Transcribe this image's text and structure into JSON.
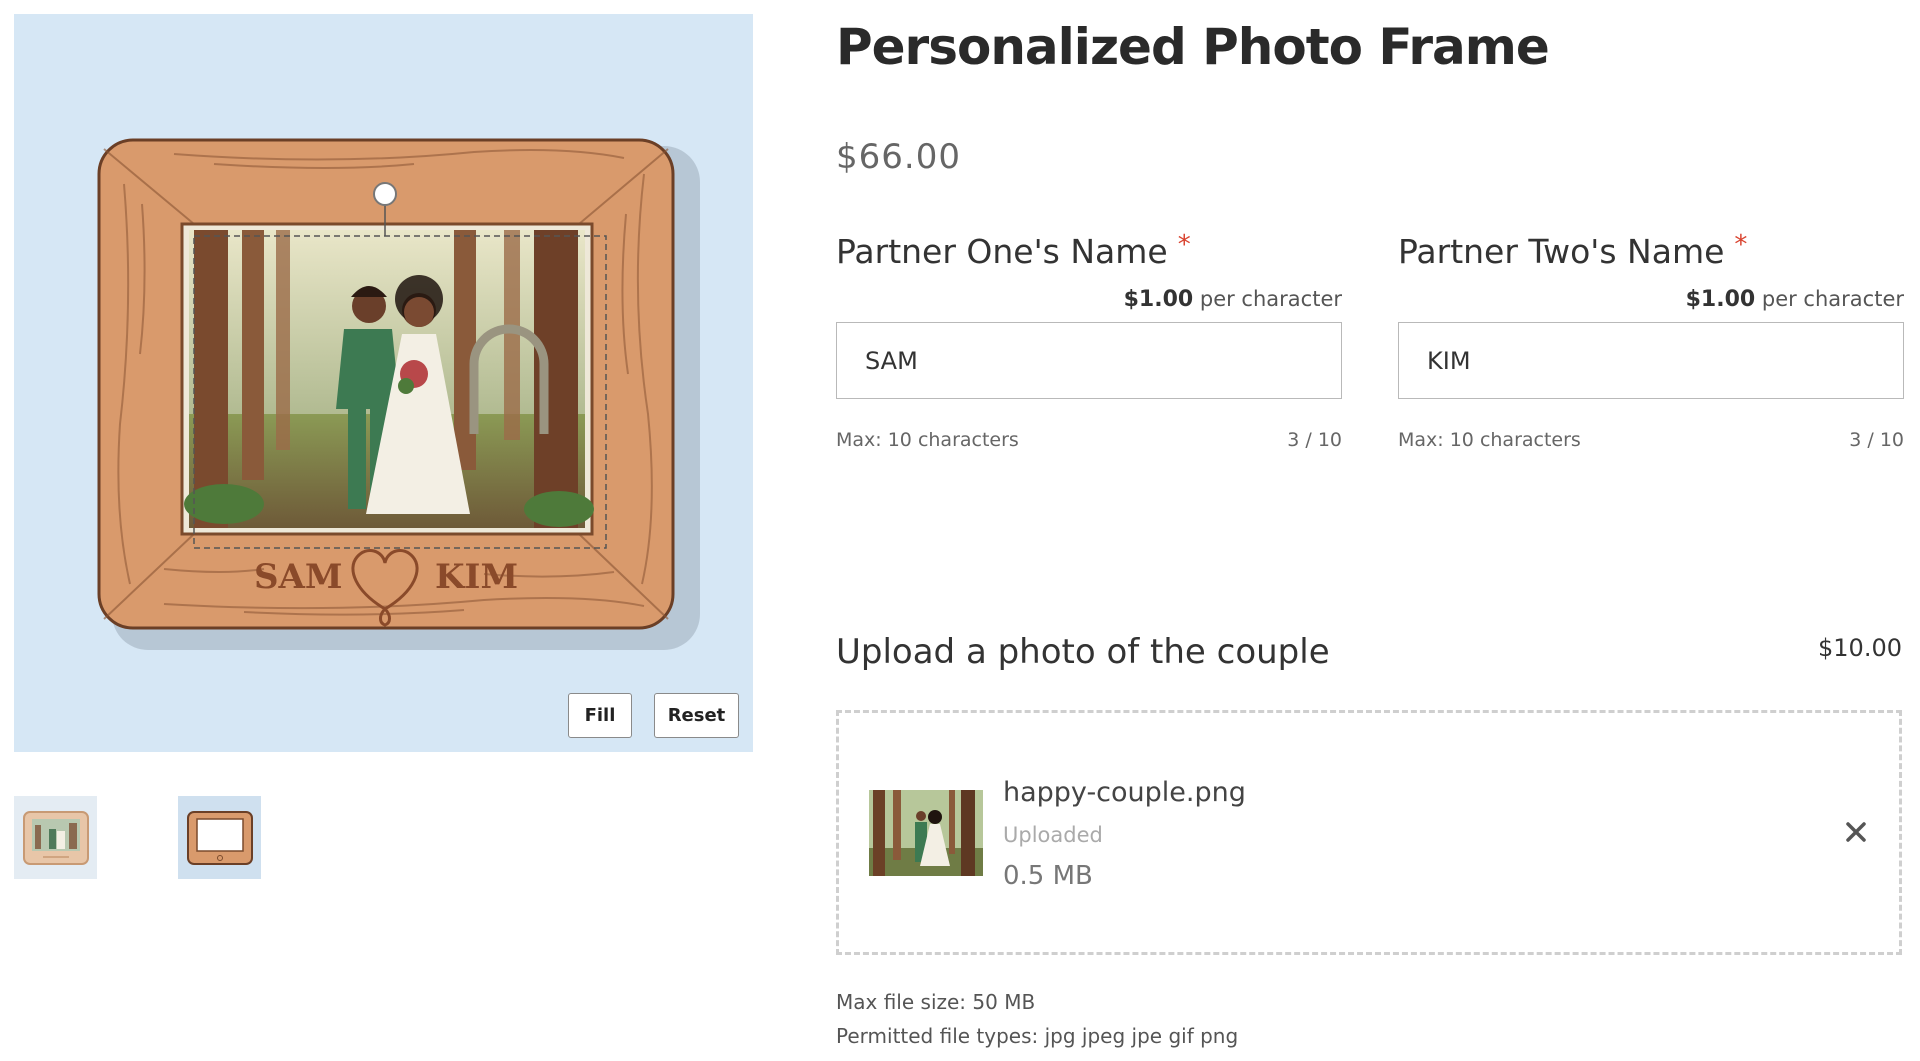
{
  "product": {
    "title": "Personalized Photo Frame",
    "price": "$66.00"
  },
  "preview": {
    "engraving_left": "SAM",
    "engraving_right": "KIM",
    "fill_label": "Fill",
    "reset_label": "Reset",
    "background_color": "#d6e7f5",
    "frame_color": "#d99a6c"
  },
  "thumbnails": [
    {
      "icon": "frame-with-photo-thumbnail"
    },
    {
      "icon": "empty-frame-thumbnail"
    }
  ],
  "fields": [
    {
      "label": "Partner One's Name",
      "required_mark": "*",
      "price_amount": "$1.00",
      "price_suffix": "per character",
      "value": "SAM",
      "max_text": "Max: 10 characters",
      "count": "3 / 10"
    },
    {
      "label": "Partner Two's Name",
      "required_mark": "*",
      "price_amount": "$1.00",
      "price_suffix": "per character",
      "value": "KIM",
      "max_text": "Max: 10 characters",
      "count": "3 / 10"
    }
  ],
  "upload": {
    "title": "Upload a photo of the couple",
    "price": "$10.00",
    "file": {
      "name": "happy-couple.png",
      "status": "Uploaded",
      "size": "0.5 MB"
    },
    "max_size": "Max file size: 50 MB",
    "permitted_types": "Permitted file types: jpg jpeg jpe gif png"
  },
  "colors": {
    "required": "#d9432f",
    "text": "#333333"
  }
}
